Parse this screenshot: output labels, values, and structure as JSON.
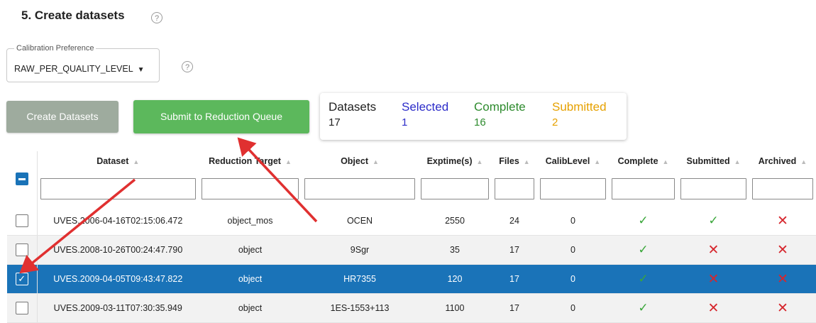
{
  "section": {
    "title": "5. Create datasets",
    "help_glyph": "?"
  },
  "calibration": {
    "legend": "Calibration Preference",
    "value": "RAW_PER_QUALITY_LEVEL",
    "help_glyph": "?"
  },
  "buttons": {
    "create": "Create Datasets",
    "submit": "Submit to Reduction Queue"
  },
  "stats": {
    "datasets_label": "Datasets",
    "datasets_value": "17",
    "selected_label": "Selected",
    "selected_value": "1",
    "complete_label": "Complete",
    "complete_value": "16",
    "submitted_label": "Submitted",
    "submitted_value": "2"
  },
  "table": {
    "columns": [
      "Dataset",
      "Reduction Target",
      "Object",
      "Exptime(s)",
      "Files",
      "CalibLevel",
      "Complete",
      "Submitted",
      "Archived"
    ],
    "rows": [
      {
        "dataset": "UVES.2006-04-16T02:15:06.472",
        "target": "object_mos",
        "object": "OCEN",
        "exptime": "2550",
        "files": "24",
        "calib": "0",
        "complete": true,
        "submitted": true,
        "archived": false,
        "selected": false
      },
      {
        "dataset": "UVES.2008-10-26T00:24:47.790",
        "target": "object",
        "object": "9Sgr",
        "exptime": "35",
        "files": "17",
        "calib": "0",
        "complete": true,
        "submitted": false,
        "archived": false,
        "selected": false
      },
      {
        "dataset": "UVES.2009-04-05T09:43:47.822",
        "target": "object",
        "object": "HR7355",
        "exptime": "120",
        "files": "17",
        "calib": "0",
        "complete": true,
        "submitted": false,
        "archived": false,
        "selected": true
      },
      {
        "dataset": "UVES.2009-03-11T07:30:35.949",
        "target": "object",
        "object": "1ES-1553+113",
        "exptime": "1100",
        "files": "17",
        "calib": "0",
        "complete": true,
        "submitted": false,
        "archived": false,
        "selected": false
      }
    ]
  },
  "icons": {
    "check": "✓",
    "cross": "✕",
    "sort": "▲",
    "caret": "▼"
  },
  "colors": {
    "accent": "#1a73b8",
    "submit_button": "#5cb85c",
    "create_button": "#9eab9e",
    "arrow": "#e03030"
  }
}
